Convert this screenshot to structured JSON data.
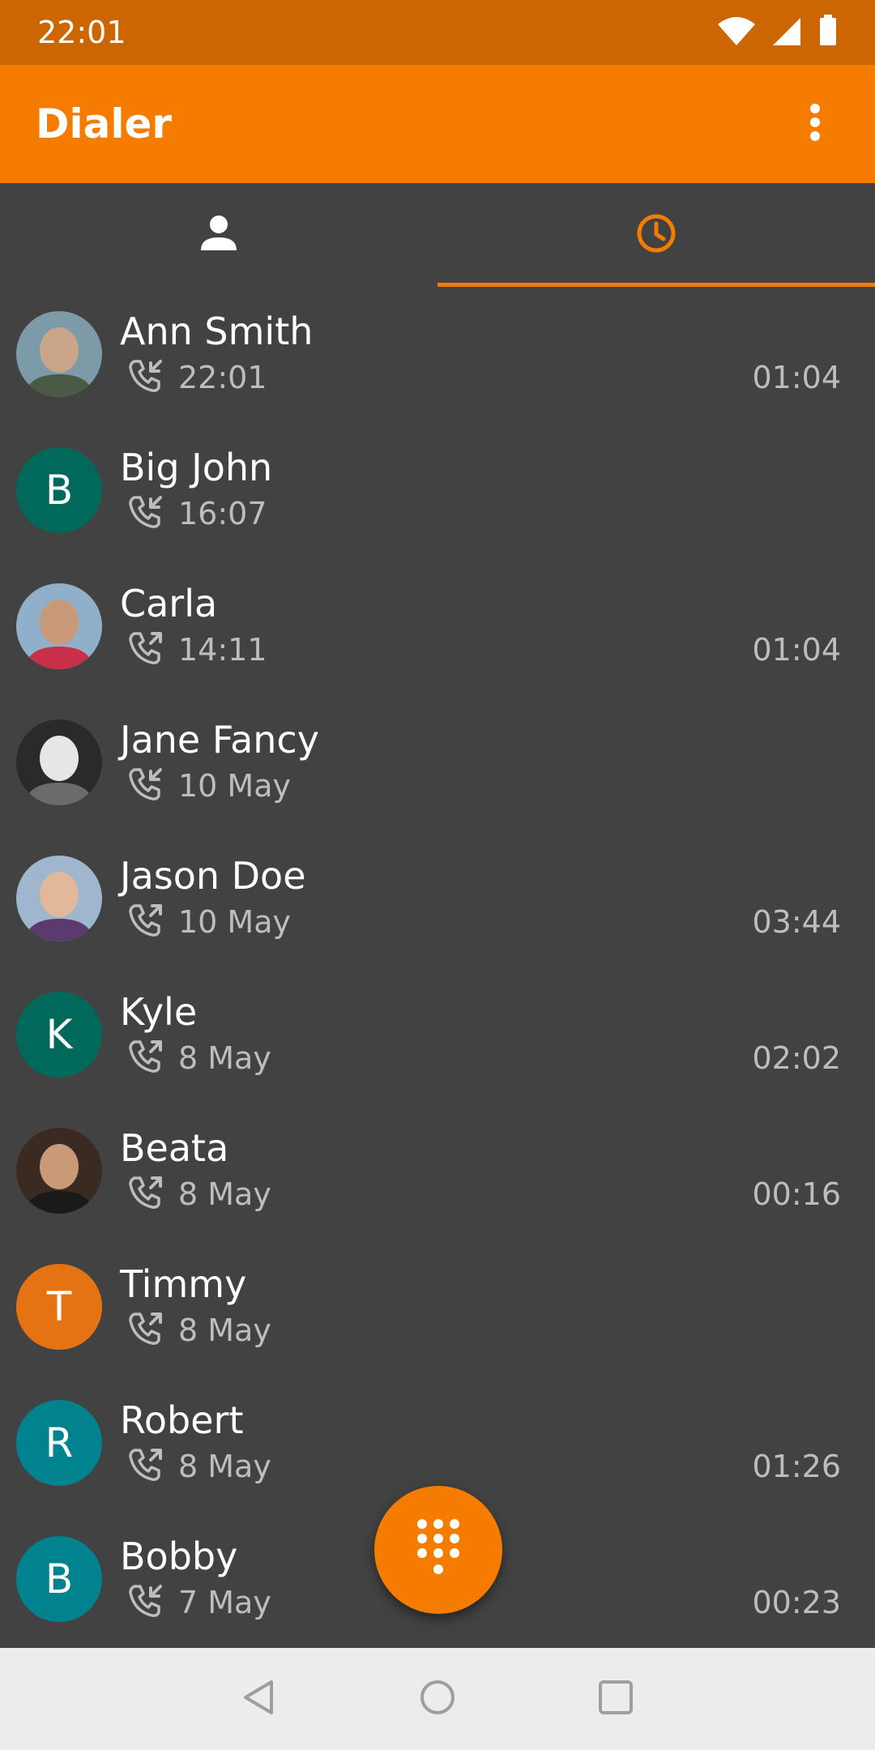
{
  "status_bar": {
    "time": "22:01",
    "icons": [
      "wifi-icon",
      "signal-icon",
      "battery-icon"
    ]
  },
  "app_bar": {
    "title": "Dialer",
    "menu_icon": "more-vert-icon"
  },
  "tabs": [
    {
      "name": "contacts",
      "icon": "person-icon",
      "selected": false
    },
    {
      "name": "recents",
      "icon": "clock-icon",
      "selected": true
    }
  ],
  "colors": {
    "status_bar": "#cc6600",
    "accent": "#f57c00",
    "background": "#424242",
    "secondary_text": "#bdbdbd",
    "nav_bar": "#ececec"
  },
  "calls": [
    {
      "name": "Ann Smith",
      "direction": "incoming",
      "time": "22:01",
      "duration": "01:04",
      "avatar": {
        "type": "photo"
      }
    },
    {
      "name": "Big John",
      "direction": "incoming",
      "time": "16:07",
      "duration": "",
      "avatar": {
        "type": "letter",
        "letter": "B",
        "color": "#00695c"
      }
    },
    {
      "name": "Carla",
      "direction": "outgoing",
      "time": "14:11",
      "duration": "01:04",
      "avatar": {
        "type": "photo"
      }
    },
    {
      "name": "Jane Fancy",
      "direction": "incoming",
      "time": "10 May",
      "duration": "",
      "avatar": {
        "type": "photo"
      }
    },
    {
      "name": "Jason Doe",
      "direction": "outgoing",
      "time": "10 May",
      "duration": "03:44",
      "avatar": {
        "type": "photo"
      }
    },
    {
      "name": "Kyle",
      "direction": "outgoing",
      "time": "8 May",
      "duration": "02:02",
      "avatar": {
        "type": "letter",
        "letter": "K",
        "color": "#00695c"
      }
    },
    {
      "name": "Beata",
      "direction": "outgoing",
      "time": "8 May",
      "duration": "00:16",
      "avatar": {
        "type": "photo"
      }
    },
    {
      "name": "Timmy",
      "direction": "outgoing",
      "time": "8 May",
      "duration": "",
      "avatar": {
        "type": "letter",
        "letter": "T",
        "color": "#e67312"
      }
    },
    {
      "name": "Robert",
      "direction": "outgoing",
      "time": "8 May",
      "duration": "01:26",
      "avatar": {
        "type": "letter",
        "letter": "R",
        "color": "#00838f"
      }
    },
    {
      "name": "Bobby",
      "direction": "incoming",
      "time": "7 May",
      "duration": "00:23",
      "avatar": {
        "type": "letter",
        "letter": "B",
        "color": "#00838f"
      }
    }
  ],
  "fab": {
    "icon": "dialpad-icon"
  },
  "nav_bar": {
    "buttons": [
      "back-icon",
      "home-icon",
      "recents-icon"
    ]
  }
}
